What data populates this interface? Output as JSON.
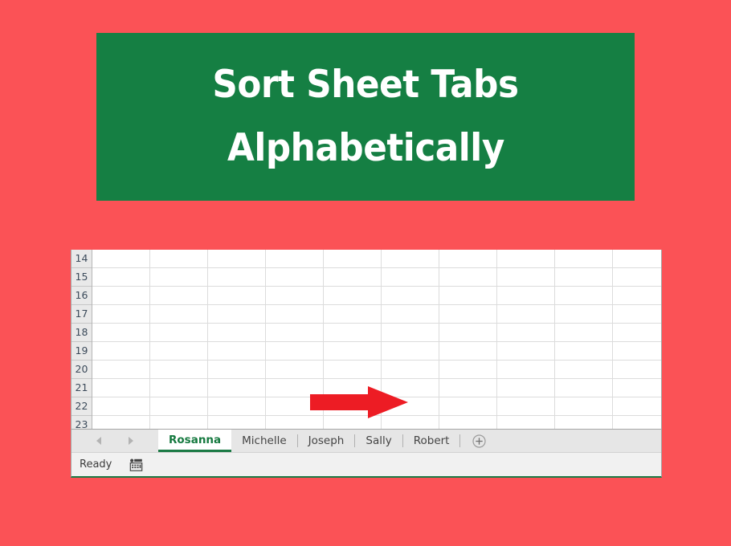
{
  "background_color": "#fb5256",
  "banner": {
    "background_color": "#157f43",
    "text_color": "#ffffff",
    "line1": "Sort Sheet Tabs",
    "line2": "Alphabetically"
  },
  "spreadsheet": {
    "row_headers": [
      "14",
      "15",
      "16",
      "17",
      "18",
      "19",
      "20",
      "21",
      "22",
      "23"
    ],
    "column_count": 10,
    "grid_line_color": "#dcdcdc",
    "row_header_bg": "#e9e9e9"
  },
  "annotation": {
    "arrow_icon": "right-arrow-icon",
    "arrow_color": "#ed1c24",
    "direction": "right"
  },
  "tab_bar": {
    "background_color": "#e6e6e6",
    "nav_prev_icon": "chevron-left-icon",
    "nav_next_icon": "chevron-right-icon",
    "new_sheet_icon": "plus-circle-icon",
    "active_tab_color": "#15793f",
    "tabs": [
      {
        "label": "Rosanna",
        "active": true
      },
      {
        "label": "Michelle",
        "active": false
      },
      {
        "label": "Joseph",
        "active": false
      },
      {
        "label": "Sally",
        "active": false
      },
      {
        "label": "Robert",
        "active": false
      }
    ]
  },
  "status_bar": {
    "status": "Ready",
    "accessibility_icon": "accessibility-checker-icon"
  }
}
